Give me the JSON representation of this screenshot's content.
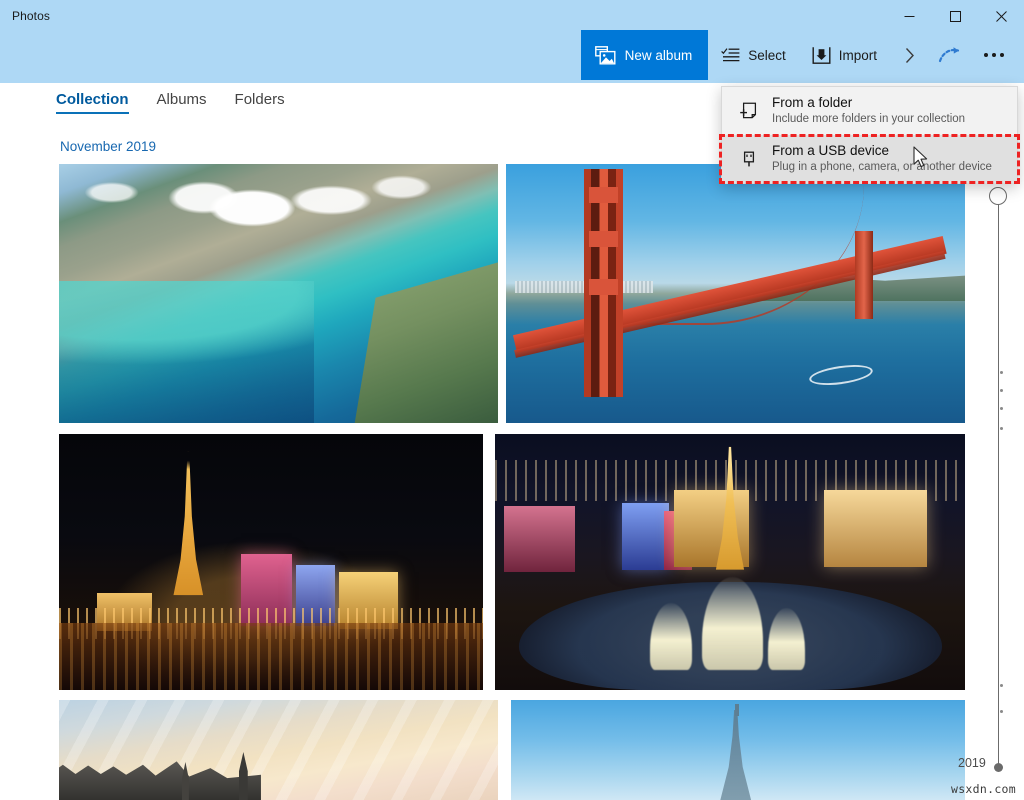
{
  "window": {
    "app_title": "Photos",
    "controls": [
      {
        "name": "minimize",
        "glyph": "minimize-icon"
      },
      {
        "name": "maximize",
        "glyph": "maximize-icon"
      },
      {
        "name": "close",
        "glyph": "close-icon"
      }
    ],
    "titlebar_color": "#aed8f5"
  },
  "toolbar": {
    "new_album_label": "New album",
    "new_album_icon": "new-album-icon",
    "new_album_color": "#0078d7",
    "select_label": "Select",
    "select_icon": "select-icon",
    "import_label": "Import",
    "import_icon": "import-icon",
    "chevron_icon": "chevron-right-icon",
    "share_icon": "share-arc-icon",
    "more_icon": "more-ellipsis-icon"
  },
  "tabs": [
    {
      "label": "Collection",
      "active": true
    },
    {
      "label": "Albums",
      "active": false
    },
    {
      "label": "Folders",
      "active": false
    }
  ],
  "content": {
    "month_label": "November 2019",
    "month_color": "#1868b0",
    "photos": [
      {
        "name": "aerial-coastline-photo",
        "alt": "Aerial view of a turquoise coastal city"
      },
      {
        "name": "golden-gate-bridge-photo",
        "alt": "Golden Gate Bridge over the bay"
      },
      {
        "name": "paris-night-skyline-photo",
        "alt": "Illuminated night skyline with tower and river"
      },
      {
        "name": "las-vegas-fountains-photo",
        "alt": "Las Vegas strip at night with fountains"
      },
      {
        "name": "paris-rooftops-photo",
        "alt": "Rooftops under a warm streaked sky"
      },
      {
        "name": "eiffel-tower-sky-photo",
        "alt": "Eiffel Tower against clear blue sky"
      }
    ]
  },
  "import_menu": {
    "items": [
      {
        "title": "From a folder",
        "subtitle": "Include more folders in your collection",
        "icon": "folder-add-icon",
        "hovered": false
      },
      {
        "title": "From a USB device",
        "subtitle": "Plug in a phone, camera, or another device",
        "icon": "usb-device-icon",
        "hovered": true
      }
    ]
  },
  "annotation": {
    "color": "#ee2222",
    "style": "dashed",
    "target": "From a USB device"
  },
  "timeline": {
    "year_label": "2019",
    "handle_icon": "timeline-handle-icon"
  },
  "watermark": {
    "text": "wsxdn.com"
  }
}
